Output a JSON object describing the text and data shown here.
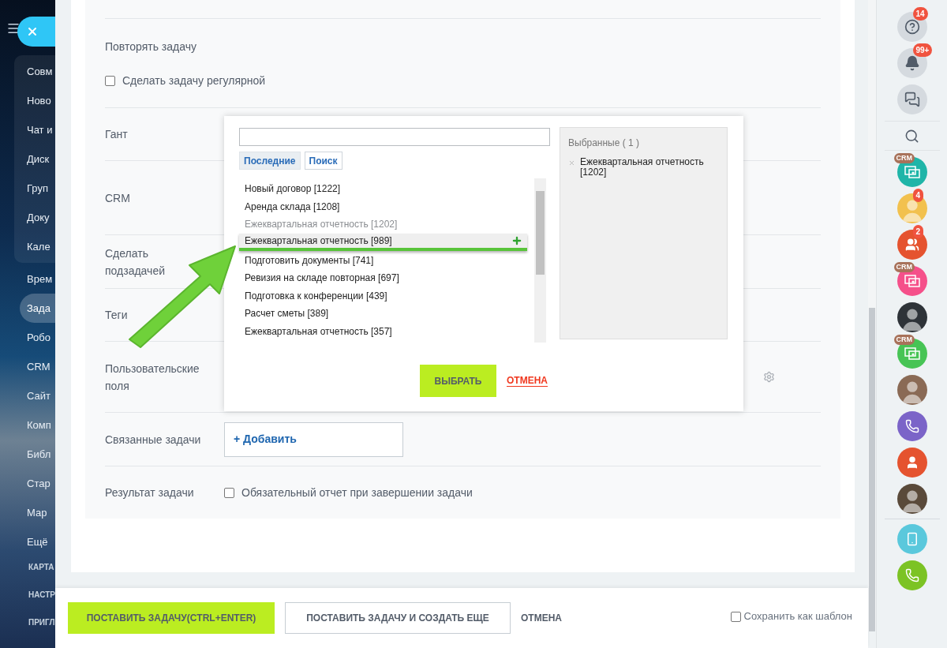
{
  "sidebar": {
    "group": [
      {
        "label": "Совм",
        "selected": false
      },
      {
        "label": "Ново",
        "selected": false
      },
      {
        "label": "Чат и",
        "selected": false
      },
      {
        "label": "Диск",
        "selected": false
      },
      {
        "label": "Груп",
        "selected": false
      },
      {
        "label": "Доку",
        "selected": false
      },
      {
        "label": "Кале",
        "selected": false
      }
    ],
    "items": [
      {
        "label": "Врем",
        "selected": false
      },
      {
        "label": "Зада",
        "selected": true
      },
      {
        "label": "Робо",
        "selected": false
      },
      {
        "label": "CRM",
        "selected": false
      },
      {
        "label": "Сайт",
        "selected": false
      },
      {
        "label": "Комп",
        "selected": false
      },
      {
        "label": "Библ",
        "selected": false
      },
      {
        "label": "Стар",
        "selected": false
      },
      {
        "label": "Мар",
        "selected": false
      },
      {
        "label": "Ещё",
        "selected": false
      }
    ],
    "section_links": [
      "КАРТА",
      "НАСТР",
      "ПРИГЛ"
    ]
  },
  "form": {
    "rows": [
      {
        "kind": "checkbox",
        "label": "Повторять задачу",
        "checkbox_label": "Сделать задачу регулярной",
        "checked": false
      },
      {
        "kind": "plain",
        "label": "Гант"
      },
      {
        "kind": "plain",
        "label": "CRM"
      },
      {
        "kind": "plain",
        "label": "Сделать подзадачей"
      },
      {
        "kind": "plain",
        "label": "Теги"
      },
      {
        "kind": "settings",
        "label": "Пользовательские поля"
      },
      {
        "kind": "add",
        "label": "Связанные задачи",
        "button": "+ Добавить"
      },
      {
        "kind": "inline_checkbox",
        "label": "Результат задачи",
        "checkbox_label": "Обязательный отчет при завершении задачи",
        "checked": false
      }
    ]
  },
  "popup": {
    "tabs": [
      {
        "label": "Последние",
        "selected": true
      },
      {
        "label": "Поиск",
        "selected": false
      }
    ],
    "items": [
      {
        "label": "Новый договор [1222]",
        "chosen": false,
        "highlighted": false
      },
      {
        "label": "Аренда склада [1208]",
        "chosen": false,
        "highlighted": false
      },
      {
        "label": "Ежеквартальная отчетность [1202]",
        "chosen": true,
        "highlighted": false
      },
      {
        "label": "Ежеквартальная отчетность [989]",
        "chosen": false,
        "highlighted": true
      },
      {
        "label": "Подготовить документы [741]",
        "chosen": false,
        "highlighted": false
      },
      {
        "label": "Ревизия на складе повторная [697]",
        "chosen": false,
        "highlighted": false
      },
      {
        "label": "Подготовка к конференции [439]",
        "chosen": false,
        "highlighted": false
      },
      {
        "label": "Расчет сметы [389]",
        "chosen": false,
        "highlighted": false
      },
      {
        "label": "Ежеквартальная отчетность [357]",
        "chosen": false,
        "highlighted": false
      }
    ],
    "selected_panel": {
      "title": "Выбранные ( 1 )",
      "items": [
        "Ежеквартальная отчетность [1202]"
      ]
    },
    "confirm": "ВЫБРАТЬ",
    "cancel": "ОТМЕНА"
  },
  "footer": {
    "primary": "ПОСТАВИТЬ ЗАДАЧУ(CTRL+ENTER)",
    "secondary": "ПОСТАВИТЬ ЗАДАЧУ И СОЗДАТЬ ЕЩЕ",
    "cancel": "ОТМЕНА",
    "template": {
      "label": "Сохранить как шаблон",
      "checked": false
    }
  },
  "right_rail": [
    {
      "kind": "help",
      "color": "#d5dadf",
      "badge": "14"
    },
    {
      "kind": "bell",
      "color": "#d5dadf",
      "badge": "99+"
    },
    {
      "kind": "chat",
      "color": "#d5dadf"
    },
    {
      "kind": "search"
    },
    {
      "kind": "crm",
      "color": "#1fb5a8",
      "tag": "CRM"
    },
    {
      "kind": "avatar",
      "color": "#f2c14e",
      "badge": "4"
    },
    {
      "kind": "group",
      "color": "#e5532f",
      "badge": "2"
    },
    {
      "kind": "crm",
      "color": "#f5508a",
      "tag": "CRM"
    },
    {
      "kind": "avatar",
      "color": "#2e3338"
    },
    {
      "kind": "crm",
      "color": "#47c455",
      "tag": "CRM"
    },
    {
      "kind": "avatar",
      "color": "#8a6a55"
    },
    {
      "kind": "phone",
      "color": "#7b64c8"
    },
    {
      "kind": "person",
      "color": "#e5532f"
    },
    {
      "kind": "avatar",
      "color": "#5a4a3a"
    },
    {
      "kind": "divider"
    },
    {
      "kind": "device",
      "color": "#5ac8dc"
    },
    {
      "kind": "phone",
      "color": "#7cc324"
    }
  ]
}
